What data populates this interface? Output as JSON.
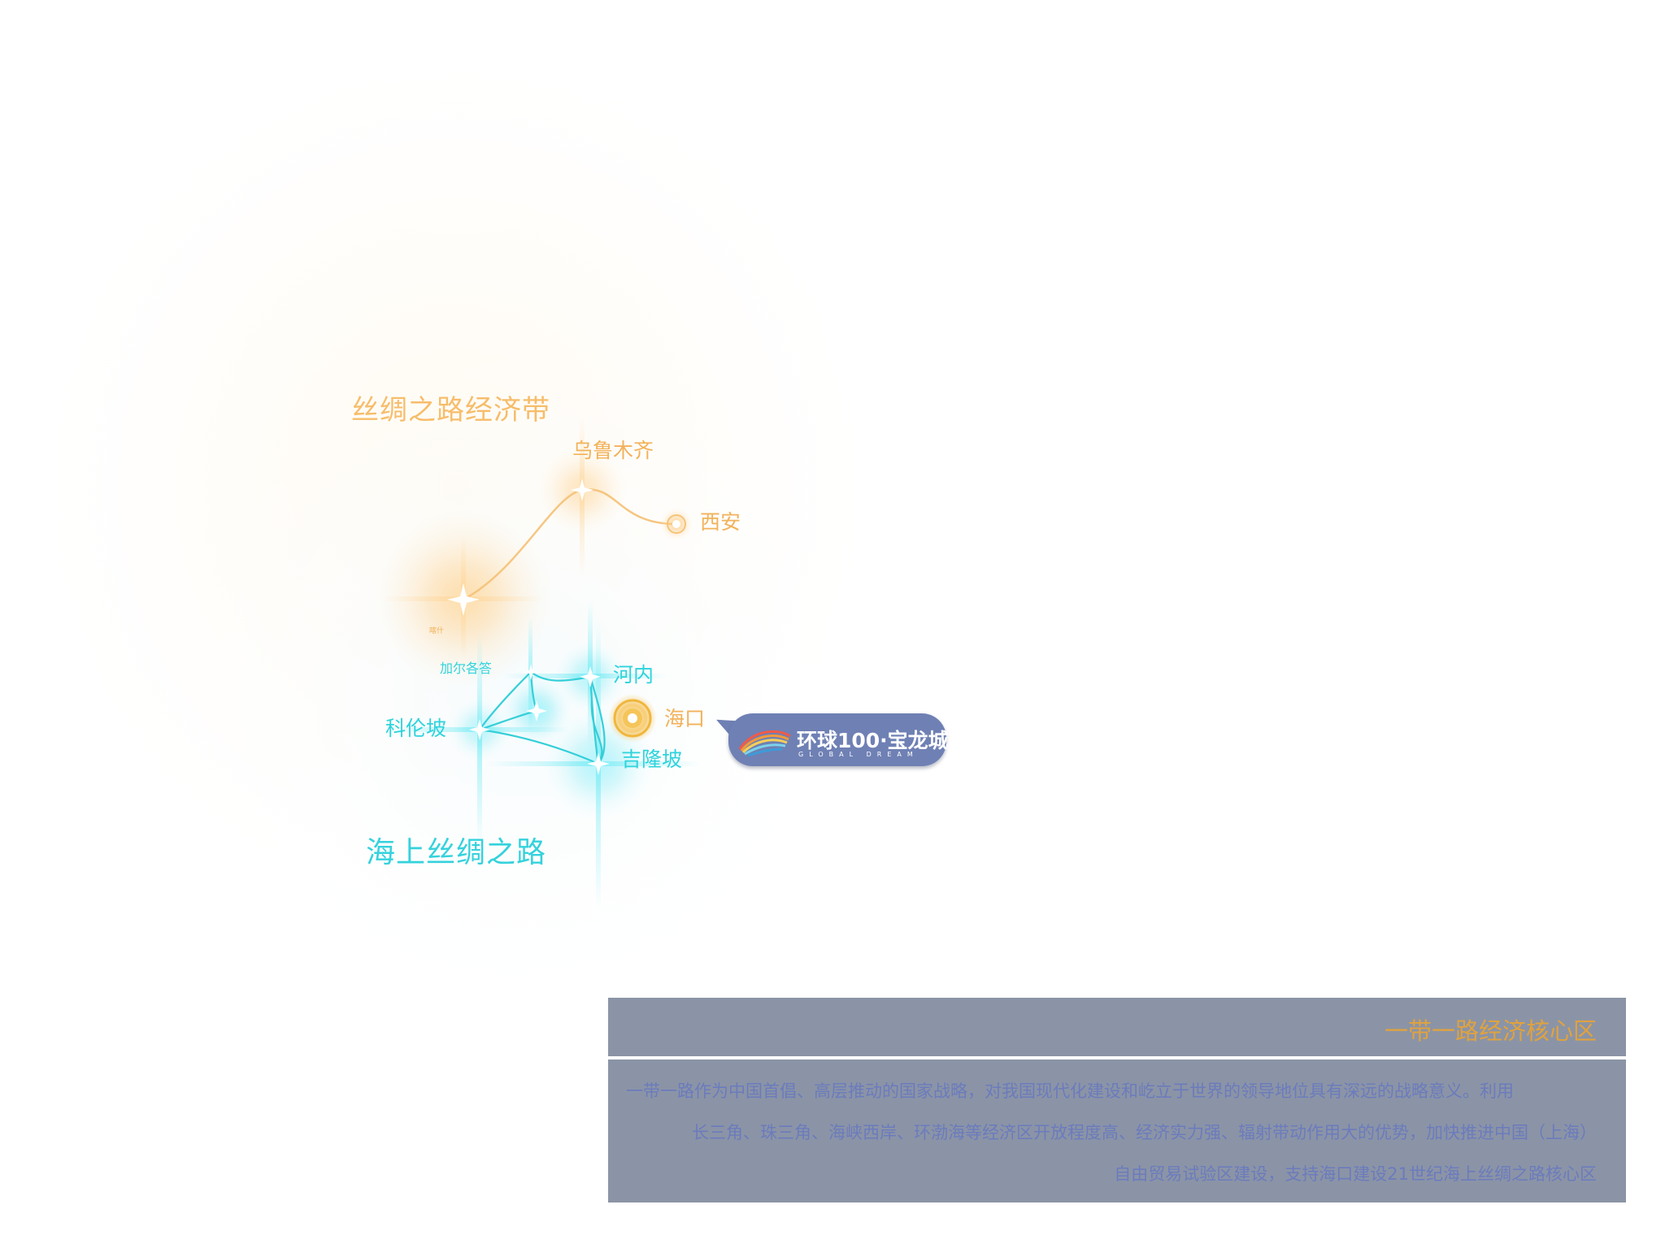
{
  "map": {
    "silk_road_title": "丝绸之路经济带",
    "maritime_title": "海上丝绸之路",
    "cities": {
      "urumqi": "乌鲁木齐",
      "xian": "西安",
      "kashgar": "喀什",
      "calcutta": "加尔各答",
      "hanoi": "河内",
      "haikou": "海口",
      "colombo": "科伦坡",
      "kuala_lumpur": "吉隆坡"
    },
    "colors": {
      "silk_road": "#f2b25a",
      "maritime": "#2fd3dc",
      "haikou_marker": "#f0b73c"
    }
  },
  "brand": {
    "name": "环球100·宝龙城",
    "subtitle": "GLOBAL DREAM",
    "logo_icon": "sunrise-wave-logo-icon",
    "color": "#6f80b4"
  },
  "info_panel": {
    "title": "一带一路经济核心区",
    "lines": [
      "一带一路作为中国首倡、高层推动的国家战略，对我国现代化建设和屹立于世界的领导地位具有深远的战略意义。利用",
      "长三角、珠三角、海峡西岸、环渤海等经济区开放程度高、经济实力强、辐射带动作用大的优势，加快推进中国（上海）",
      "自由贸易试验区建设，支持海口建设21世纪海上丝绸之路核心区"
    ],
    "bg_color": "#8b94a6",
    "title_color": "#e0a23e",
    "text_color": "#6b7bbd"
  }
}
